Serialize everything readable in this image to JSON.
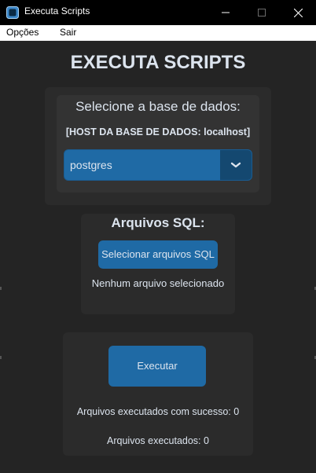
{
  "window": {
    "title": "Executa Scripts",
    "controls": {
      "minimize": "minimize-icon",
      "maximize": "maximize-icon",
      "close": "close-icon"
    }
  },
  "menu": {
    "items": [
      {
        "label": "Opções"
      },
      {
        "label": "Sair"
      }
    ]
  },
  "main": {
    "heading": "EXECUTA SCRIPTS"
  },
  "database": {
    "label": "Selecione a base de dados:",
    "host_text": "[HOST DA BASE DE DADOS: localhost]",
    "selected": "postgres"
  },
  "sql_files": {
    "label": "Arquivos SQL:",
    "button_label": "Selecionar arquivos SQL",
    "status": "Nenhum arquivo selecionado"
  },
  "execution": {
    "button_label": "Executar",
    "success_text": "Arquivos executados com sucesso: 0",
    "total_text": "Arquivos executados: 0"
  },
  "colors": {
    "background": "#242424",
    "frame": "#2b2b2b",
    "accent": "#1f6aa5",
    "accent_dark": "#144870",
    "text": "#dce4ee"
  }
}
